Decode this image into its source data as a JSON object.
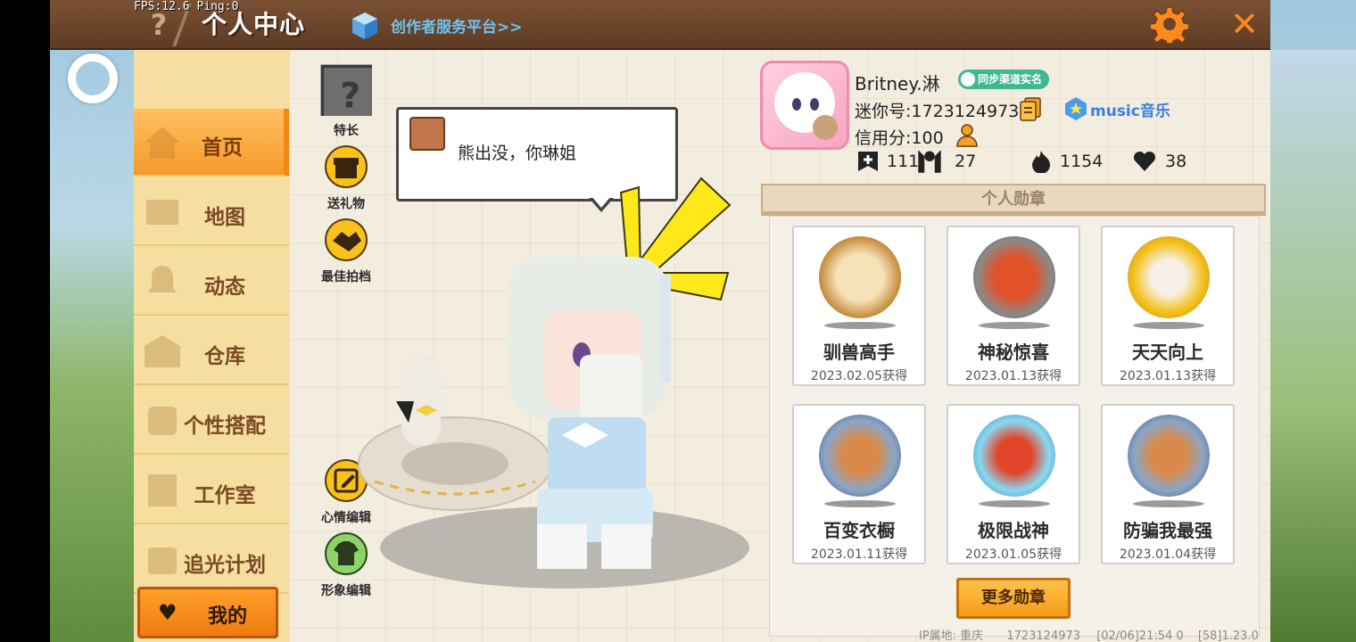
{
  "hud": {
    "fps_ping": "FPS:12.6  Ping:0"
  },
  "header": {
    "help_glyph": "?",
    "title": "个人中心",
    "creator_link": "创作者服务平台>>",
    "close_glyph": "✕"
  },
  "nav": {
    "items": [
      {
        "label": "首页"
      },
      {
        "label": "地图"
      },
      {
        "label": "动态"
      },
      {
        "label": "仓库"
      },
      {
        "label": "个性搭配"
      },
      {
        "label": "工作室"
      },
      {
        "label": "追光计划"
      }
    ],
    "mine_label": "我的"
  },
  "side_actions": {
    "talent": "特长",
    "gift": "送礼物",
    "partner": "最佳拍档",
    "mood_edit": "心情编辑",
    "look_edit": "形象编辑"
  },
  "bubble": {
    "text": "熊出没，你琳姐"
  },
  "profile": {
    "name": "Britney.淋",
    "verify_badge": "同步渠道实名",
    "mini_id": "迷你号:1723124973",
    "music_label": "music音乐",
    "credit": "信用分:100",
    "stats": {
      "posts": "111",
      "fans": "27",
      "heat": "1154",
      "likes": "38"
    }
  },
  "medals": {
    "header": "个人勋章",
    "items": [
      {
        "name": "驯兽高手",
        "date": "2023.02.05获得",
        "color": "#e8b35a"
      },
      {
        "name": "神秘惊喜",
        "date": "2023.01.13获得",
        "color": "#8a8a8a"
      },
      {
        "name": "天天向上",
        "date": "2023.01.13获得",
        "color": "#f2c21e"
      },
      {
        "name": "百变衣橱",
        "date": "2023.01.11获得",
        "color": "#6f87a8"
      },
      {
        "name": "极限战神",
        "date": "2023.01.05获得",
        "color": "#6fc6ea"
      },
      {
        "name": "防骗我最强",
        "date": "2023.01.04获得",
        "color": "#6f87a8"
      }
    ],
    "more_button": "更多勋章"
  },
  "footer": {
    "location": "IP属地: 重庆",
    "uid": "1723124973",
    "time": "[02/06]21:54 0",
    "version": "[58]1.23.0"
  },
  "colors": {
    "accent_orange": "#f59a2a",
    "nav_bg": "#f5dea0",
    "topbar": "#6a442a"
  }
}
